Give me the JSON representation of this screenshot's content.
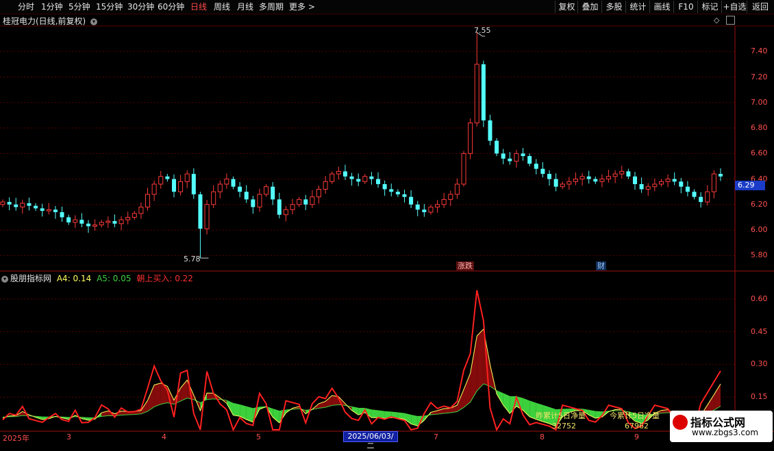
{
  "toolbar": {
    "periods": [
      "分时",
      "1分钟",
      "5分钟",
      "15分钟",
      "30分钟",
      "60分钟",
      "日线",
      "周线",
      "月线",
      "多周期",
      "更多 >"
    ],
    "active_period": "日线",
    "right_buttons": [
      "复权",
      "叠加",
      "多股",
      "统计",
      "画线",
      "F10",
      "标记",
      "+自选",
      "返回"
    ]
  },
  "chart_header": {
    "title": "桂冠电力(日线,前复权)"
  },
  "main_chart": {
    "price_axis": [
      "7.40",
      "7.20",
      "7.00",
      "6.80",
      "6.60",
      "6.40",
      "6.20",
      "6.00",
      "5.80"
    ],
    "current_price": "6.29",
    "high_annot": "7.55",
    "low_annot": "5.78",
    "events": [
      {
        "label": "涨跌",
        "color": "#ff6060"
      },
      {
        "label": "财",
        "color": "#60a0ff"
      }
    ]
  },
  "indicator": {
    "name": "股朋指标网",
    "a4": "A4: 0.14",
    "a5": "A5: 0.05",
    "buy": "朝上买入: 0.22",
    "axis": [
      "0.60",
      "0.45",
      "0.30",
      "0.15"
    ],
    "stat1_label": "昨累计5日净量",
    "stat1_value": "32752",
    "stat2_label": "今累计5日净量",
    "stat2_value": "67962"
  },
  "x_axis": {
    "labels": [
      "2025年",
      "3",
      "4",
      "5",
      "7",
      "8",
      "9"
    ],
    "selected_date": "2025/06/03/二"
  },
  "watermark": {
    "title": "指标公式网",
    "url": "www.zbgs3.com"
  },
  "chart_data": {
    "type": "candlestick",
    "title": "桂冠电力(日线,前复权)",
    "ylim": [
      5.7,
      7.6
    ],
    "series": [
      {
        "name": "price_close",
        "values": [
          6.22,
          6.2,
          6.18,
          6.21,
          6.19,
          6.17,
          6.15,
          6.16,
          6.14,
          6.1,
          6.06,
          6.08,
          6.05,
          6.03,
          6.04,
          6.06,
          6.07,
          6.05,
          6.08,
          6.1,
          6.13,
          6.18,
          6.28,
          6.36,
          6.42,
          6.4,
          6.3,
          6.38,
          6.44,
          6.28,
          6.01,
          6.2,
          6.3,
          6.36,
          6.4,
          6.34,
          6.3,
          6.24,
          6.18,
          6.28,
          6.34,
          6.24,
          6.12,
          6.16,
          6.2,
          6.24,
          6.2,
          6.26,
          6.32,
          6.38,
          6.44,
          6.46,
          6.42,
          6.4,
          6.38,
          6.42,
          6.4,
          6.36,
          6.32,
          6.3,
          6.28,
          6.26,
          6.2,
          6.16,
          6.14,
          6.18,
          6.2,
          6.24,
          6.28,
          6.36,
          6.6,
          6.84,
          7.3,
          6.86,
          6.7,
          6.6,
          6.56,
          6.54,
          6.6,
          6.58,
          6.52,
          6.48,
          6.44,
          6.4,
          6.34,
          6.36,
          6.38,
          6.4,
          6.42,
          6.4,
          6.38,
          6.4,
          6.42,
          6.44,
          6.46,
          6.42,
          6.36,
          6.32,
          6.34,
          6.36,
          6.38,
          6.4,
          6.38,
          6.34,
          6.3,
          6.26,
          6.22,
          6.3,
          6.44,
          6.42
        ]
      }
    ],
    "indicator_series": [
      {
        "name": "朝上买入",
        "color": "#ff2020"
      },
      {
        "name": "A4",
        "color": "#ffff60"
      },
      {
        "name": "A5",
        "color": "#40d040"
      }
    ],
    "indicator_ylim": [
      0,
      0.7
    ]
  }
}
